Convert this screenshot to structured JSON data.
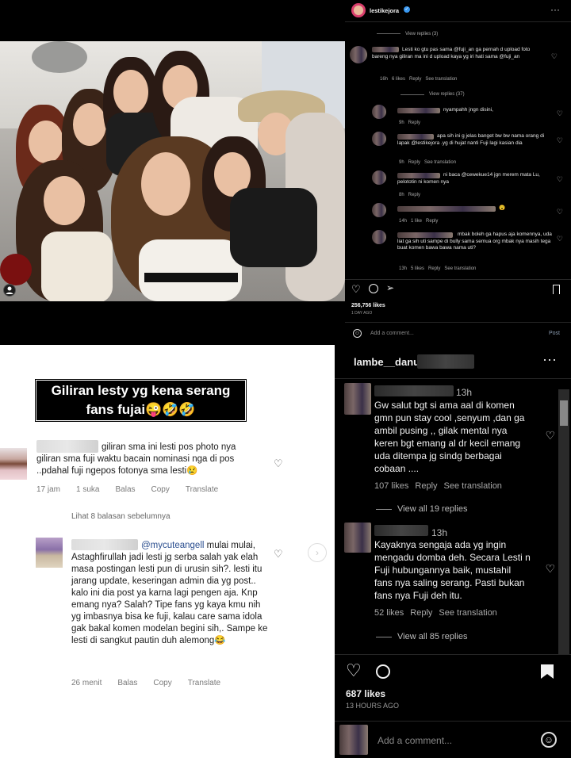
{
  "post_photo": {
    "alt_icon": "person-tag-icon"
  },
  "ig_post": {
    "username": "lestikejora",
    "verified_icon": "verified-badge-icon",
    "more_icon": "more-dots-icon",
    "view_replies_1": "View replies (3)",
    "comment1": {
      "text": "Lesti ko gtu pas sama @fuji_an ga pernah d upload foto bareng nya giliran ma ini d upload kaya yg iri hati sama @fuji_an",
      "meta": "16h   6 likes   Reply   See translation"
    },
    "view_replies_2": "View replies (37)",
    "replies": [
      {
        "text": "nyampahh jngn disini,",
        "meta": "9h   Reply"
      },
      {
        "text": "apa sih ini g jelas banget bw bw nama orang di lapak @lestikejora .yg di hujat nanti Fuji lagi kasian dia",
        "meta": "9h   Reply   See translation"
      },
      {
        "text": "ni baca @cewekue14 jgn merem mata Lu, pelototin ni komen nya",
        "meta": "8h   Reply"
      },
      {
        "text": "😮",
        "meta": "14h   1 like   Reply"
      },
      {
        "text": "mbak boleh ga hapus aja komennya, uda liat ga sih uti sampe di bully sama semua org mbak nya masih tega buat komen bawa bawa nama uti?",
        "meta": "13h   5 likes   Reply   See translation"
      }
    ],
    "likes": "256,756 likes",
    "time": "1 DAY AGO",
    "add_comment_placeholder": "Add a comment...",
    "post_label": "Post"
  },
  "fb_comments": {
    "caption": "Giliran lesty yg kena serang fans fujai😜🤣🤣",
    "comment1": {
      "text": "giliran sma ini lesti pos photo nya giliran sma fuji waktu bacain nominasi nga di pos ..pdahal fuji ngepos fotonya sma lesti😢",
      "meta": [
        "17 jam",
        "1 suka",
        "Balas",
        "Copy",
        "Translate"
      ]
    },
    "prev_replies": "Lihat 8 balasan sebelumnya",
    "comment2": {
      "mention": "@mycuteangell",
      "text": " mulai mulai, Astaghfirullah jadi lesti jg serba salah yak elah masa postingan lesti pun di urusin sih?. lesti itu jarang update, keseringan admin dia yg post.. kalo ini dia post ya karna lagi pengen aja. Knp emang nya? Salah? Tipe fans yg kaya kmu nih yg imbasnya bisa ke fuji, kalau care sama idola gak bakal komen modelan begini sih,. Sampe ke lesti di sangkut pautin duh alemong😂",
      "meta": [
        "26 menit",
        "Balas",
        "Copy",
        "Translate"
      ]
    }
  },
  "ig_dark": {
    "username": "lambe__danu",
    "more_icon": "more-dots-icon",
    "comment1": {
      "time": "13h",
      "text": "Gw salut bgt si ama aal di komen gmn pun stay cool ,senyum ,dan ga ambil pusing ,, gilak mental nya keren bgt emang al dr kecil emang uda ditempa jg sindg berbagai cobaan ....",
      "likes": "107 likes",
      "reply": "Reply",
      "translate": "See translation",
      "view_replies": "View all 19 replies"
    },
    "comment2": {
      "time": "13h",
      "text": "Kayaknya sengaja ada yg ingin mengadu domba deh. Secara Lesti n Fuji hubungannya baik, mustahil fans nya saling serang. Pasti bukan fans nya Fuji deh itu.",
      "likes": "52 likes",
      "reply": "Reply",
      "translate": "See translation",
      "view_replies": "View all 85 replies"
    },
    "likes": "687 likes",
    "time": "13 HOURS AGO",
    "add_comment_placeholder": "Add a comment...",
    "emoji_icon": "emoji-icon"
  }
}
